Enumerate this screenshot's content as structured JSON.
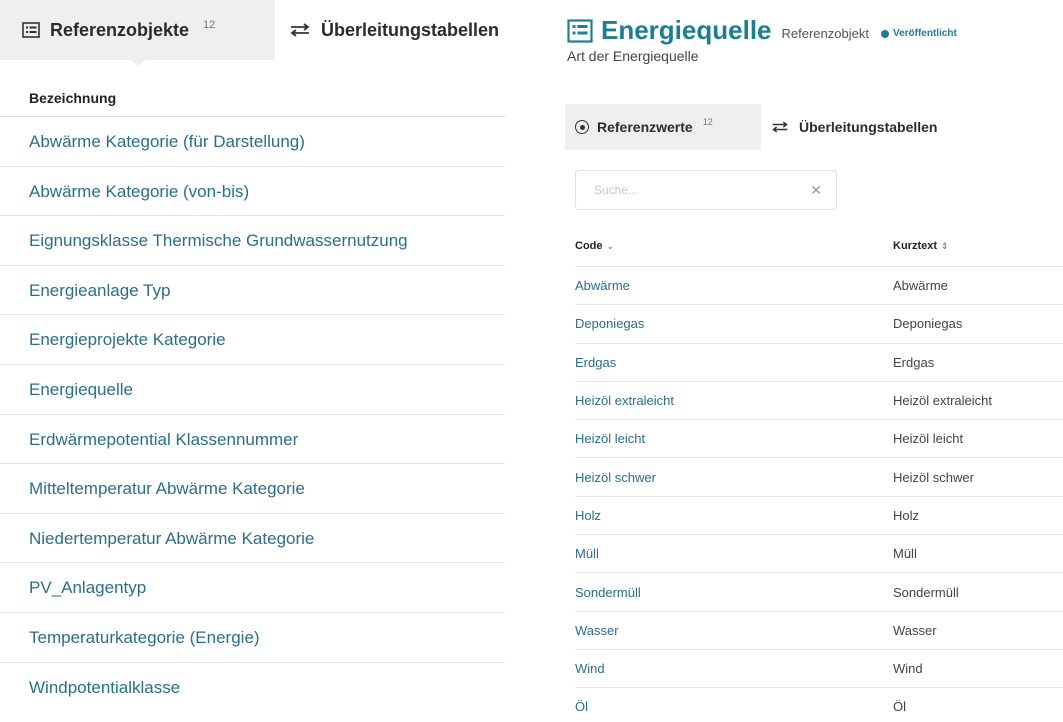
{
  "left": {
    "tabs": [
      {
        "label": "Referenzobjekte",
        "badge": "12",
        "icon": "table-list-icon"
      },
      {
        "label": "Überleitungstabellen",
        "icon": "exchange-arrows-icon"
      }
    ],
    "column_header": "Bezeichnung",
    "items": [
      "Abwärme Kategorie (für Darstellung)",
      "Abwärme Kategorie (von-bis)",
      "Eignungsklasse Thermische Grundwassernutzung",
      "Energieanlage Typ",
      "Energieprojekte Kategorie",
      "Energiequelle",
      "Erdwärmepotential Klassennummer",
      "Mitteltemperatur Abwärme Kategorie",
      "Niedertemperatur Abwärme Kategorie",
      "PV_Anlagentyp",
      "Temperaturkategorie (Energie)",
      "Windpotentialklasse"
    ]
  },
  "right": {
    "title": "Energiequelle",
    "type_label": "Referenzobjekt",
    "status": "Veröffentlicht",
    "subtitle": "Art der Energiequelle",
    "tabs": [
      {
        "label": "Referenzwerte",
        "badge": "12",
        "icon": "radio-target-icon"
      },
      {
        "label": "Überleitungstabellen",
        "icon": "exchange-arrows-icon"
      }
    ],
    "search": {
      "placeholder": "Suche...",
      "value": ""
    },
    "columns": {
      "code": "Code",
      "kurztext": "Kurztext"
    },
    "rows": [
      {
        "code": "Abwärme",
        "kurztext": "Abwärme"
      },
      {
        "code": "Deponiegas",
        "kurztext": "Deponiegas"
      },
      {
        "code": "Erdgas",
        "kurztext": "Erdgas"
      },
      {
        "code": "Heizöl extraleicht",
        "kurztext": "Heizöl extraleicht"
      },
      {
        "code": "Heizöl leicht",
        "kurztext": "Heizöl leicht"
      },
      {
        "code": "Heizöl schwer",
        "kurztext": "Heizöl schwer"
      },
      {
        "code": "Holz",
        "kurztext": "Holz"
      },
      {
        "code": "Müll",
        "kurztext": "Müll"
      },
      {
        "code": "Sondermüll",
        "kurztext": "Sondermüll"
      },
      {
        "code": "Wasser",
        "kurztext": "Wasser"
      },
      {
        "code": "Wind",
        "kurztext": "Wind"
      },
      {
        "code": "Öl",
        "kurztext": "Öl"
      }
    ]
  },
  "colors": {
    "link": "#2b6e8a",
    "accent": "#1d7e92",
    "tab_active_bg": "#efefef"
  }
}
